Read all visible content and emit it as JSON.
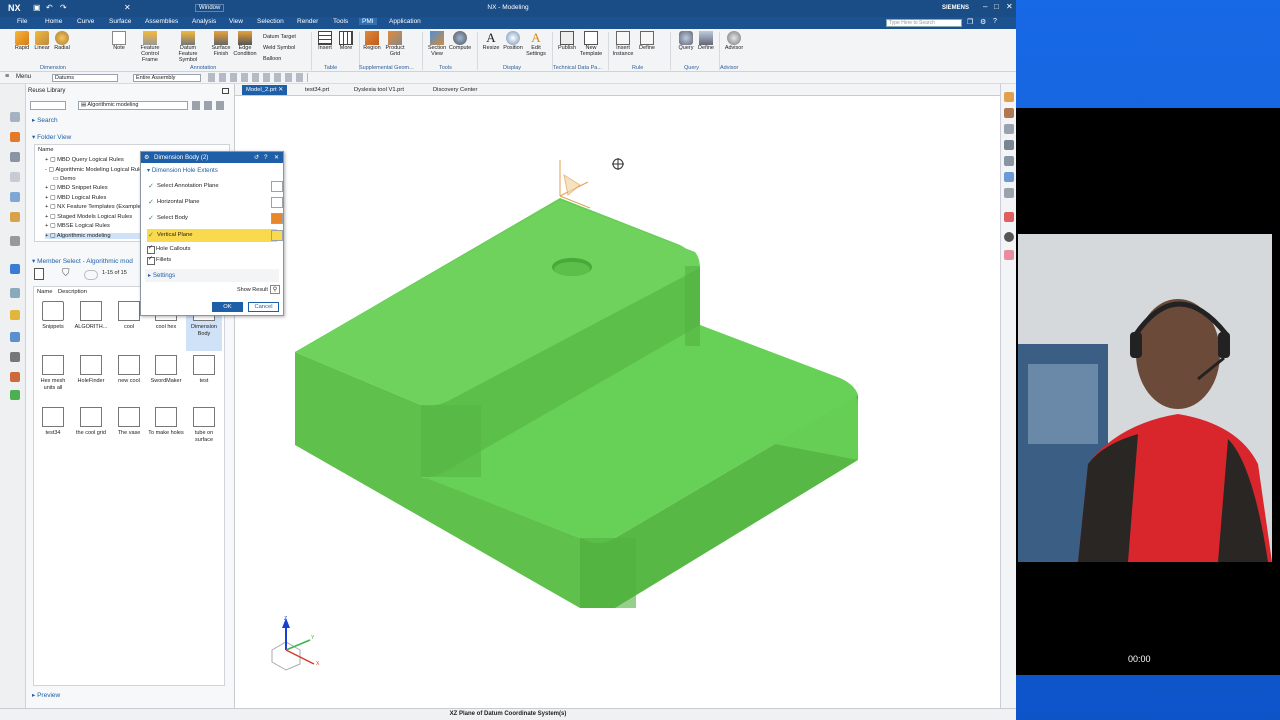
{
  "app": {
    "logo": "NX",
    "title": "NX - Modeling",
    "brand": "SIEMENS",
    "window_menu": "Window",
    "search_placeholder": "Type Here to Search"
  },
  "menu": [
    "File",
    "Home",
    "Curve",
    "Surface",
    "Assemblies",
    "Analysis",
    "View",
    "Selection",
    "Render",
    "Tools",
    "PMI",
    "Application"
  ],
  "menu_active": "PMI",
  "ribbon": {
    "buttons": [
      {
        "label": "Rapid"
      },
      {
        "label": "Linear"
      },
      {
        "label": "Radial"
      },
      {
        "label": "Note"
      },
      {
        "label": "Feature Control Frame"
      },
      {
        "label": "Datum Feature Symbol"
      },
      {
        "label": "Surface Finish"
      },
      {
        "label": "Edge Condition"
      },
      {
        "label": "Insert"
      },
      {
        "label": "More"
      },
      {
        "label": "Region"
      },
      {
        "label": "Product Grid"
      },
      {
        "label": "Section View"
      },
      {
        "label": "Compute"
      },
      {
        "label": "Resize"
      },
      {
        "label": "Position"
      },
      {
        "label": "Edit Settings"
      },
      {
        "label": "Publish"
      },
      {
        "label": "New Template"
      },
      {
        "label": "Insert Instance"
      },
      {
        "label": "Define"
      },
      {
        "label": "Query"
      },
      {
        "label": "Define"
      },
      {
        "label": "Advisor"
      }
    ],
    "small_items": [
      "Datum Target",
      "Weld Symbol",
      "Balloon"
    ],
    "groups": [
      "Dimension",
      "Annotation",
      "Table",
      "Supplemental Geom...",
      "Tools",
      "Display",
      "Technical Data Pa...",
      "Rule",
      "Query",
      "Advisor"
    ]
  },
  "quickbar": {
    "menu_label": "Menu",
    "filter_value": "Datums",
    "scope_value": "Entire Assembly"
  },
  "nav": {
    "title": "Reuse Library",
    "search_label": "Search",
    "library_combo": "Algorithmic modeling",
    "folder_view_label": "Folder View",
    "name_header": "Name",
    "tree": [
      "MBD Query Logical Rules",
      "Algorithmic Modeling Logical Rule",
      "Demo",
      "MBD Snippet Rules",
      "MBD Logical Rules",
      "NX Feature Templates (Example)",
      "Staged Models Logical Rules",
      "MBSE Logical Rules",
      "Algorithmic modeling"
    ],
    "member_select_label": "Member Select - Algorithmic mod",
    "member_count": "1-15 of 15",
    "columns": [
      "Name",
      "Description"
    ],
    "members": [
      "Snippets",
      "ALGORITH...",
      "cool",
      "cool hex",
      "Dimension Body",
      "Hex mesh units all",
      "HoleFinder",
      "new cool",
      "SwordMaker",
      "test",
      "test34",
      "the cool grid",
      "The vase",
      "To make holes",
      "tube on surface"
    ],
    "preview_label": "Preview"
  },
  "tabs": [
    {
      "label": "Model_2.prt"
    },
    {
      "label": "test34.prt"
    },
    {
      "label": "Dyslexia tool V1.prt"
    },
    {
      "label": "Discovery Center"
    }
  ],
  "dialog": {
    "title": "Dimension Body (2)",
    "section": "Dimension Hole Extents",
    "rows": [
      "Select Annotation Plane",
      "Horizontal Plane",
      "Select Body",
      "Vertical Plane"
    ],
    "checks": [
      "Hole Callouts",
      "Fillets"
    ],
    "settings_label": "Settings",
    "show_result": "Show Result",
    "ok": "OK",
    "cancel": "Cancel"
  },
  "triad_labels": {
    "z": "Z",
    "y": "Y",
    "x": "X"
  },
  "status": "XZ Plane of Datum Coordinate System(s)",
  "timer": "00:00",
  "colors": {
    "accent": "#1f5fa8",
    "part_green": "#66cd55",
    "selected_row": "#f9d94e",
    "titlebar": "#1a4c86"
  }
}
